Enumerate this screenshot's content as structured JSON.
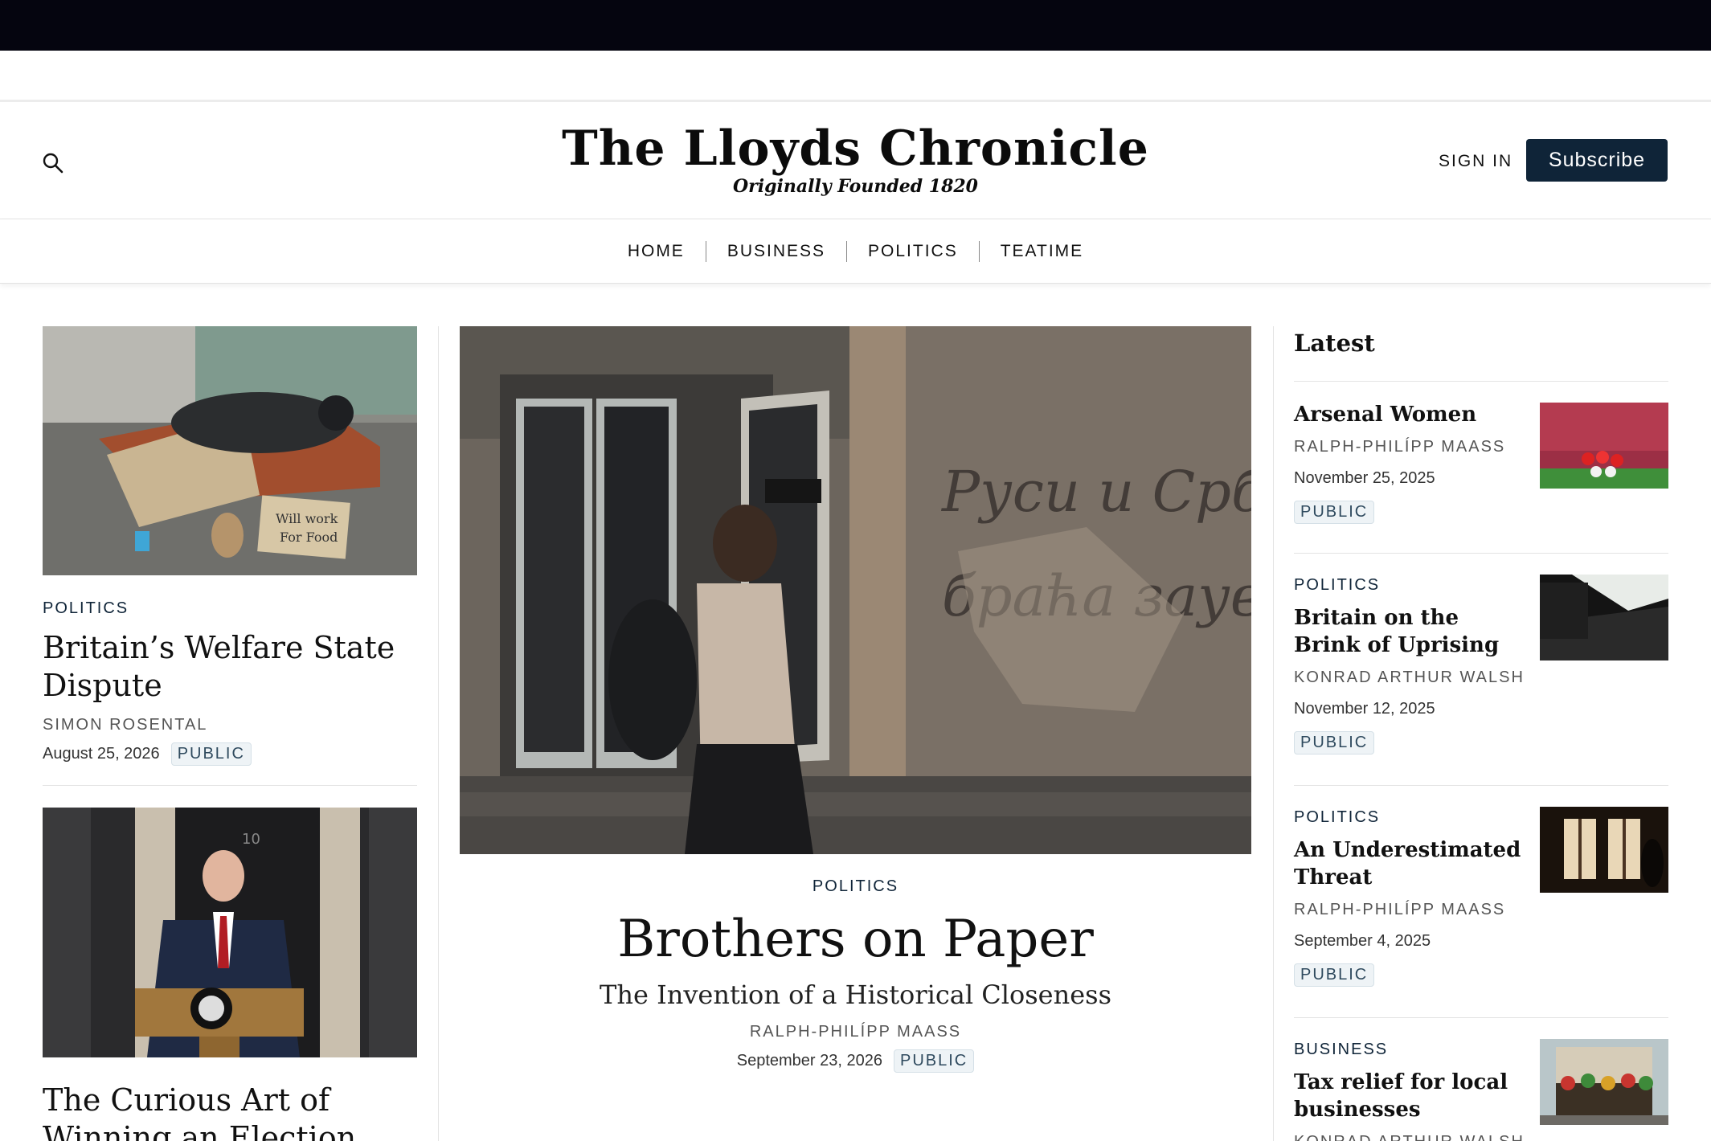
{
  "header": {
    "logo_title": "The Lloyds Chronicle",
    "logo_subtitle": "Originally Founded 1820",
    "sign_in": "SIGN IN",
    "subscribe": "Subscribe"
  },
  "nav": {
    "items": [
      "HOME",
      "BUSINESS",
      "POLITICS",
      "TEATIME"
    ]
  },
  "left": {
    "articles": [
      {
        "kicker": "POLITICS",
        "headline": "Britain’s Welfare State Dispute",
        "author": "SIMON ROSENTAL",
        "date": "August 25, 2026",
        "badge": "PUBLIC",
        "image_icon": "homeless-person-photo"
      },
      {
        "headline": "The Curious Art of Winning an Election and",
        "image_icon": "politician-at-podium-photo"
      }
    ]
  },
  "featured": {
    "kicker": "POLITICS",
    "headline": "Brothers on Paper",
    "dek": "The Invention of a Historical Closeness",
    "author": "RALPH-PHILÍPP MAASS",
    "date": "September 23, 2026",
    "badge": "PUBLIC",
    "image_icon": "street-wall-graffiti-photo"
  },
  "latest": {
    "title": "Latest",
    "items": [
      {
        "kicker": "",
        "headline": "Arsenal Women",
        "author": "RALPH-PHILÍPP MAASS",
        "date": "November 25, 2025",
        "badge": "PUBLIC",
        "image_icon": "football-team-photo"
      },
      {
        "kicker": "POLITICS",
        "headline": "Britain on the Brink of Uprising",
        "author": "KONRAD ARTHUR WALSH",
        "date": "November 12, 2025",
        "badge": "PUBLIC",
        "image_icon": "dark-train-platform-photo"
      },
      {
        "kicker": "POLITICS",
        "headline": "An Underestimated Threat",
        "author": "RALPH-PHILÍPP MAASS",
        "date": "September 4, 2025",
        "badge": "PUBLIC",
        "image_icon": "window-silhouette-photo"
      },
      {
        "kicker": "BUSINESS",
        "headline": "Tax relief for local businesses",
        "author": "KONRAD ARTHUR WALSH",
        "date": "",
        "badge": "",
        "image_icon": "pub-storefront-photo"
      }
    ]
  },
  "colors": {
    "topbar": "#05050f",
    "accent": "#0f2438",
    "badge_bg": "#eef3f6"
  }
}
